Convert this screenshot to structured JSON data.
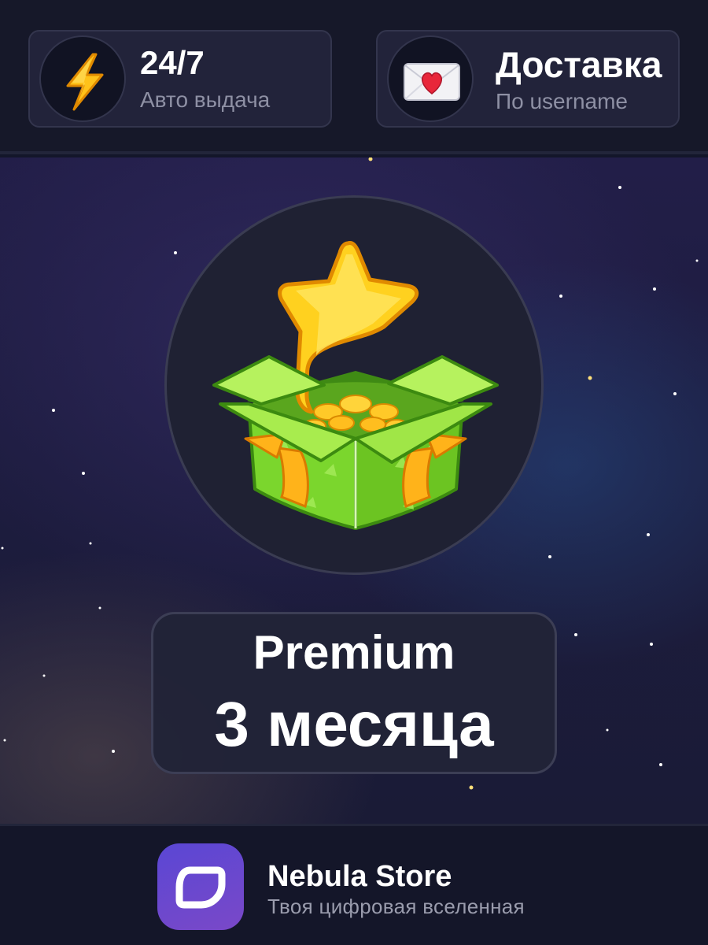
{
  "features": [
    {
      "icon": "lightning-icon",
      "title": "24/7",
      "subtitle": "Авто выдача"
    },
    {
      "icon": "love-letter-icon",
      "title": "Доставка",
      "subtitle": "По username"
    }
  ],
  "product": {
    "image": "gift-box-star-icon",
    "name": "Premium",
    "duration": "3 месяца"
  },
  "store": {
    "logo": "nebula-logo-icon",
    "name": "Nebula Store",
    "tagline": "Твоя цифровая вселенная"
  },
  "colors": {
    "background": "#13162a",
    "card": "#22233a",
    "accent_purple": "#6a47d0",
    "gift_green": "#7ee03a",
    "star_gold": "#ffcc1a"
  }
}
